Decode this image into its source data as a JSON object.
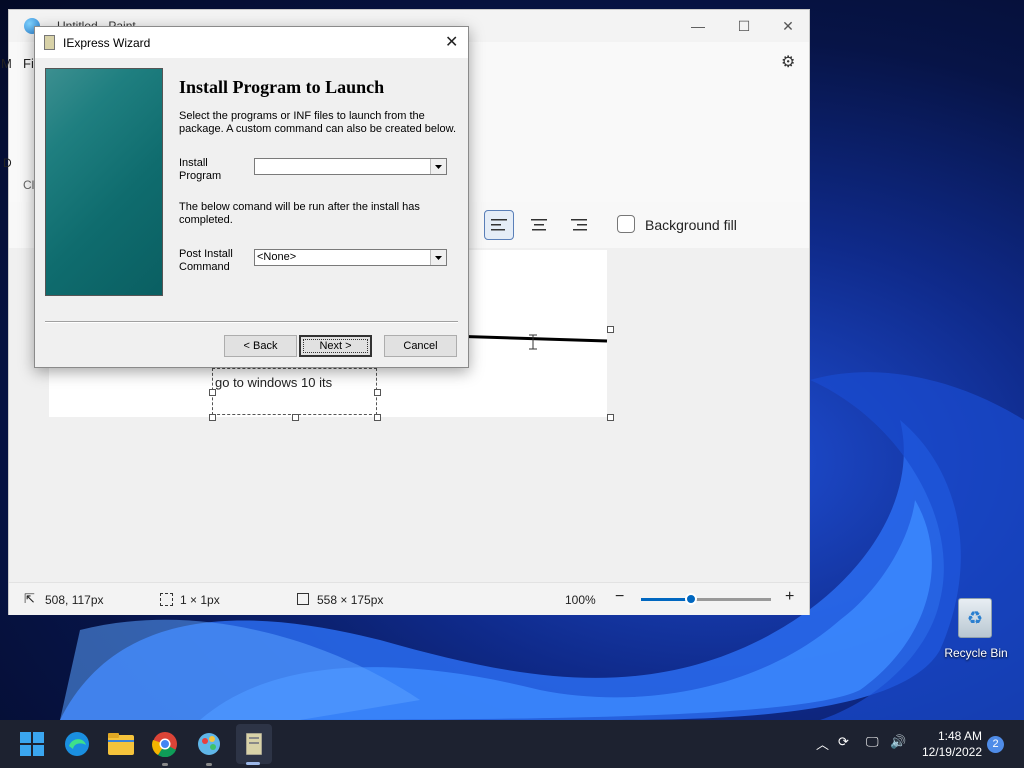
{
  "paint": {
    "title": "Untitled - Paint",
    "menu_partial": "Fi",
    "left_partial_1": "M",
    "left_partial_2": "D",
    "left_partial_3": "Cl",
    "background_fill_label": "Background fill",
    "text_box_content": "go to windows 10 its",
    "status": {
      "cursor_pos": "508, 117px",
      "selection_size": "1 × 1px",
      "canvas_size": "558 × 175px",
      "zoom": "100%"
    },
    "zoom_level_percent": 100
  },
  "wizard": {
    "title": "IExpress Wizard",
    "heading": "Install Program to Launch",
    "description": "Select the programs or INF files to launch from the package.  A custom command can also be created below.",
    "install_program_label": "Install Program",
    "install_program_value": "",
    "post_install_note": "The below comand will be run after the install has completed.",
    "post_install_label": "Post Install Command",
    "post_install_value": "<None>",
    "back_label": "< Back",
    "next_label": "Next >",
    "cancel_label": "Cancel"
  },
  "desktop": {
    "recycle_bin_label": "Recycle Bin"
  },
  "taskbar": {
    "time": "1:48 AM",
    "date": "12/19/2022",
    "notification_count": "2",
    "apps": [
      "start-icon",
      "edge-icon",
      "file-explorer-icon",
      "chrome-icon",
      "paint-icon",
      "iexpress-icon"
    ]
  }
}
